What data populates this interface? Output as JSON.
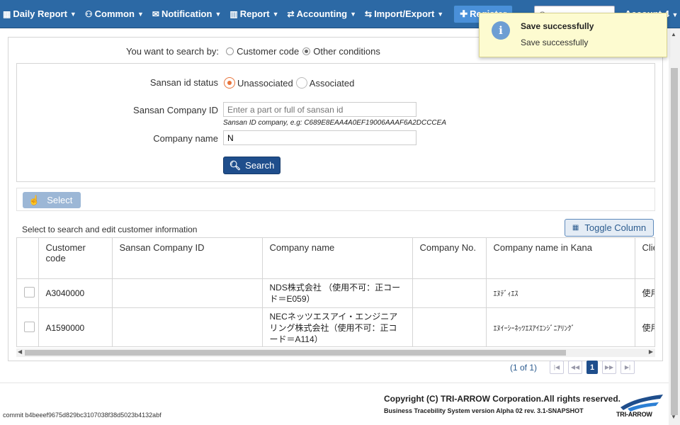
{
  "navbar": {
    "items": [
      {
        "label": "Daily Report",
        "icon": "calendar-icon"
      },
      {
        "label": "Common",
        "icon": "users-icon"
      },
      {
        "label": "Notification",
        "icon": "envelope-icon"
      },
      {
        "label": "Report",
        "icon": "bar-chart-icon"
      },
      {
        "label": "Accounting",
        "icon": "exchange-icon"
      },
      {
        "label": "Import/Export",
        "icon": "transfer-icon"
      }
    ],
    "register_label": "Register",
    "search_placeholder": "Company name",
    "account_label": "Account 4"
  },
  "search": {
    "by_label": "You want to search by:",
    "option_customer_code": "Customer code",
    "option_other_conditions": "Other conditions",
    "selected_option": "Other conditions",
    "sansan_status_label": "Sansan id status",
    "status_unassociated": "Unassociated",
    "status_associated": "Associated",
    "selected_status": "Unassociated",
    "sansan_company_id_label": "Sansan Company ID",
    "sansan_company_id_placeholder": "Enter a part or full of sansan id",
    "sansan_company_id_value": "",
    "sansan_hint": "Sansan ID company, e.g: C689E8EAA4A0EF19006AAAF6A2DCCCEA",
    "company_name_label": "Company name",
    "company_name_value": "N",
    "search_button": "Search"
  },
  "actions": {
    "select_button": "Select",
    "toggle_column_button": "Toggle Column",
    "list_title": "Select to search and edit customer information"
  },
  "table": {
    "headers": [
      "",
      "Customer code",
      "Sansan Company ID",
      "Company name",
      "Company No.",
      "Company name in Kana",
      "Clie"
    ],
    "rows": [
      {
        "customer_code": "A3040000",
        "sansan_id": "",
        "company_name": "NDS株式会社 （使用不可：正コード＝E059）",
        "company_no": "",
        "kana": "ｴﾇﾃﾞｨｴｽ",
        "client": "使用"
      },
      {
        "customer_code": "A1590000",
        "sansan_id": "",
        "company_name": "NECネッツエスアイ・エンジニアリング株式会社（使用不可：正コード＝A114）",
        "company_no": "",
        "kana": "ｴﾇｲｰｼｰﾈｯﾂｴｽｱｲｴﾝｼﾞﾆｱﾘﾝｸﾞ",
        "client": "使用"
      }
    ]
  },
  "pager": {
    "info": "(1 of 1)",
    "current_page": "1"
  },
  "footer": {
    "commit": "commit b4beeef9675d829bc3107038f38d5023b4132abf",
    "copyright": "Copyright (C) TRI-ARROW Corporation.All rights reserved.",
    "version": "Business Tracebility System version Alpha 02 rev. 3.1-SNAPSHOT",
    "logo_text": "TRI-ARROW"
  },
  "toast": {
    "title": "Save successfully",
    "message": "Save successfully"
  },
  "colors": {
    "navbar": "#2c69a5",
    "primary_button": "#1f4e8c",
    "radio_selected": "#e8743b",
    "toast_bg": "#fdfbd0"
  }
}
